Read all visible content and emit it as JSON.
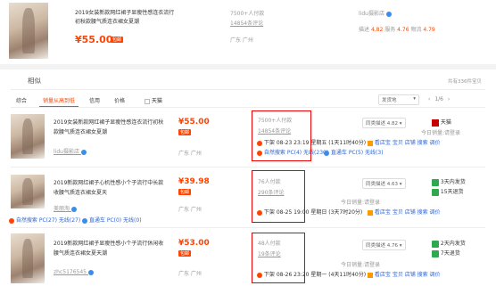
{
  "top_item": {
    "title_line1": "2019女装新款网红裙子显瘦性感连衣流行",
    "title_line2": "初秋款腰气质连衣裙女夏潮",
    "price": "¥55.00",
    "badge": "包邮",
    "payers": "7500+人付款",
    "reviews": "14854条评论",
    "location": "广东 广州",
    "shop": "lidu摄影店",
    "desc_label": "描述",
    "desc_score": "4.82",
    "service_label": "服务",
    "service_score": "4.76",
    "logistics_label": "物流",
    "logistics_score": "4.79"
  },
  "section_title": "相似",
  "total_label": "共有336件宝贝",
  "filters": {
    "tabs": [
      "综合",
      "销量从高到低",
      "信用",
      "价格"
    ],
    "tmall_label": "天猫",
    "ship_from": "发货地",
    "page": "1/6"
  },
  "rows": [
    {
      "title_line1": "2019女装新款网红裙子显瘦性感连衣流行初秋",
      "title_line2": "款腰气质连衣裙女夏潮",
      "shop": "lidu摄影店",
      "price": "¥55.00",
      "badge": "包邮",
      "location": "广东 广州",
      "payers": "7500+人付款",
      "reviews": "14854条评论",
      "timeline": "下架 08-23 23:19 星期五 (1天11时40分)",
      "natural": "自然搜索 PC(4) 无线(230)",
      "direct": "直通车 PC(5) 无线(3)",
      "score": "同类描述 4.82",
      "today_sales": "今日销量:请登录",
      "tools": "看店宝 宝贝 店铺 搜索 调价",
      "right_badge": "天猫"
    },
    {
      "title_line1": "2019新款网红裙子心机性感小个子流行中长款",
      "title_line2": "收腰气质连衣裙女夏天",
      "shop": "美丽淘",
      "price": "¥39.98",
      "badge": "包邮",
      "location": "广东 广州",
      "payers": "76人付款",
      "reviews": "290条评论",
      "timeline": "下架 08-25 19:00 星期日 (3天7时20分)",
      "natural": "自然搜索 PC(27) 无线(27)",
      "direct": "直通车 PC(0) 无线(0)",
      "score": "同类描述 4.63",
      "today_sales": "今日销量:请登录",
      "tools": "看店宝 宝贝 店铺 搜索 调价",
      "right_badge1": "3天内发货",
      "right_badge2": "15天退货"
    },
    {
      "title_line1": "2019新款网红裙子显瘦性感小个子流行休闲收",
      "title_line2": "腰气质连衣裙女夏天潮",
      "shop": "zhc5176545",
      "price": "¥53.00",
      "badge": "包邮",
      "location": "广东 广州",
      "payers": "48人付款",
      "reviews": "19条评论",
      "timeline": "下架 08-26 23:20 星期一 (4天11时40分)",
      "score": "同类描述 4.76",
      "today_sales": "今日销量:请登录",
      "tools": "看店宝 宝贝 店铺 搜索 调价",
      "right_badge1": "2天内发货",
      "right_badge2": "7天退货"
    }
  ],
  "colors": {
    "accent": "#ff4400",
    "highlight_box": "#ee0000",
    "link": "#3366cc"
  }
}
